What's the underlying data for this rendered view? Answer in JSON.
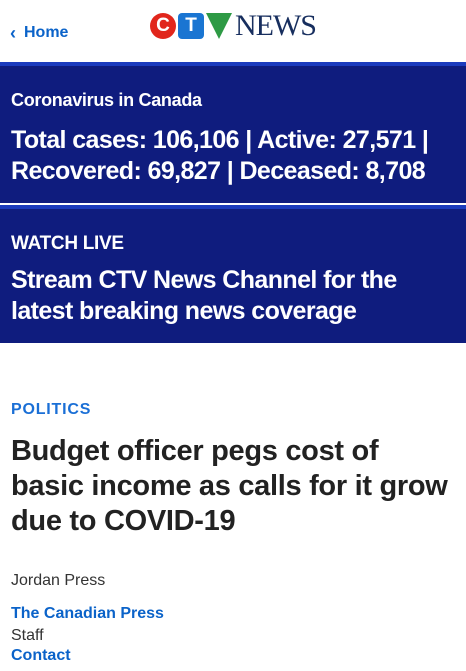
{
  "header": {
    "back_label": "Home",
    "logo_text": "NEWS",
    "logo_letters": [
      "C",
      "T",
      "V"
    ]
  },
  "covid_banner": {
    "kicker": "Coronavirus in Canada",
    "stats": "Total cases: 106,106 | Active: 27,571 | Recovered: 69,827 | Deceased: 8,708"
  },
  "live_banner": {
    "kicker": "WATCH LIVE",
    "headline": "Stream CTV News Channel for the latest breaking news coverage"
  },
  "article": {
    "section": "POLITICS",
    "title": "Budget officer pegs cost of basic income as calls for it grow due to COVID-19",
    "author": "Jordan Press",
    "publisher": "The Canadian Press",
    "staff": "Staff",
    "contact": "Contact"
  },
  "colors": {
    "banner_bg": "#0f1c7e",
    "link": "#0b63c9",
    "logo_red": "#e1261c",
    "logo_blue": "#1a75d2",
    "logo_green": "#2e9a45"
  }
}
